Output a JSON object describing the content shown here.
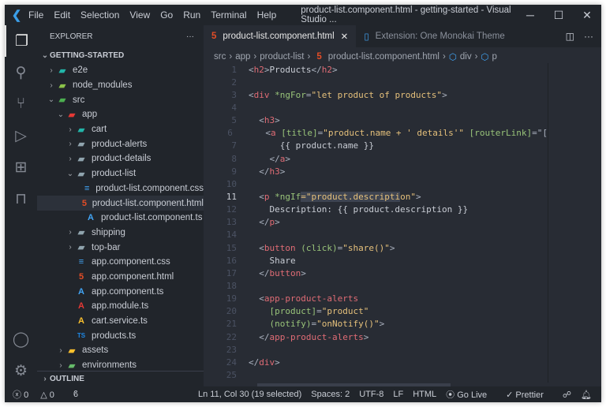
{
  "titlebar": {
    "menu": [
      "File",
      "Edit",
      "Selection",
      "View",
      "Go",
      "Run",
      "Terminal",
      "Help"
    ],
    "title": "product-list.component.html - getting-started - Visual Studio ..."
  },
  "sidebar": {
    "header": "EXPLORER",
    "more": "···",
    "section": "GETTING-STARTED",
    "outline": "OUTLINE",
    "items": [
      {
        "label": "e2e",
        "depth": 0,
        "chev": "›",
        "icon": "folder-e2e-icon",
        "color": "#22b5a9",
        "g": "▰"
      },
      {
        "label": "node_modules",
        "depth": 0,
        "chev": "›",
        "icon": "folder-node-icon",
        "color": "#8bc34a",
        "g": "▰"
      },
      {
        "label": "src",
        "depth": 0,
        "chev": "⌄",
        "icon": "folder-src-icon",
        "color": "#4caf50",
        "g": "▰"
      },
      {
        "label": "app",
        "depth": 1,
        "chev": "⌄",
        "icon": "folder-app-icon",
        "color": "#e53935",
        "g": "▰"
      },
      {
        "label": "cart",
        "depth": 2,
        "chev": "›",
        "icon": "folder-cart-icon",
        "color": "#22b5a9",
        "g": "▰"
      },
      {
        "label": "product-alerts",
        "depth": 2,
        "chev": "›",
        "icon": "folder-icon",
        "color": "#90a4ae",
        "g": "▰"
      },
      {
        "label": "product-details",
        "depth": 2,
        "chev": "›",
        "icon": "folder-icon",
        "color": "#90a4ae",
        "g": "▰"
      },
      {
        "label": "product-list",
        "depth": 2,
        "chev": "⌄",
        "icon": "folder-open-icon",
        "color": "#90a4ae",
        "g": "▰"
      },
      {
        "label": "product-list.component.css",
        "depth": 3,
        "chev": "",
        "icon": "css-icon",
        "color": "#42a5f5",
        "g": "≡"
      },
      {
        "label": "product-list.component.html",
        "depth": 3,
        "chev": "",
        "icon": "html-icon",
        "color": "#e44d26",
        "g": "5",
        "selected": true
      },
      {
        "label": "product-list.component.ts",
        "depth": 3,
        "chev": "",
        "icon": "angular-ts-icon",
        "color": "#42a5f5",
        "g": "A"
      },
      {
        "label": "shipping",
        "depth": 2,
        "chev": "›",
        "icon": "folder-icon",
        "color": "#90a4ae",
        "g": "▰"
      },
      {
        "label": "top-bar",
        "depth": 2,
        "chev": "›",
        "icon": "folder-icon",
        "color": "#90a4ae",
        "g": "▰"
      },
      {
        "label": "app.component.css",
        "depth": 2,
        "chev": "",
        "icon": "css-icon",
        "color": "#42a5f5",
        "g": "≡"
      },
      {
        "label": "app.component.html",
        "depth": 2,
        "chev": "",
        "icon": "html-icon",
        "color": "#e44d26",
        "g": "5"
      },
      {
        "label": "app.component.ts",
        "depth": 2,
        "chev": "",
        "icon": "angular-ts-icon",
        "color": "#42a5f5",
        "g": "A"
      },
      {
        "label": "app.module.ts",
        "depth": 2,
        "chev": "",
        "icon": "angular-module-icon",
        "color": "#e53935",
        "g": "A"
      },
      {
        "label": "cart.service.ts",
        "depth": 2,
        "chev": "",
        "icon": "angular-service-icon",
        "color": "#fbc02d",
        "g": "A"
      },
      {
        "label": "products.ts",
        "depth": 2,
        "chev": "",
        "icon": "ts-icon",
        "color": "#1e88e5",
        "g": "TS"
      },
      {
        "label": "assets",
        "depth": 1,
        "chev": "›",
        "icon": "folder-assets-icon",
        "color": "#fbc02d",
        "g": "▰"
      },
      {
        "label": "environments",
        "depth": 1,
        "chev": "›",
        "icon": "folder-env-icon",
        "color": "#66bb6a",
        "g": "▰"
      }
    ]
  },
  "tabs": [
    {
      "label": "product-list.component.html",
      "active": true,
      "close": "✕"
    },
    {
      "label": "Extension: One Monokai Theme",
      "active": false
    }
  ],
  "breadcrumb": [
    "src",
    "app",
    "product-list",
    "product-list.component.html",
    "div",
    "p"
  ],
  "editor": {
    "current_line": 11,
    "lines": [
      [
        [
          "<",
          "p"
        ],
        [
          "h2",
          "t"
        ],
        [
          ">",
          "p"
        ],
        [
          "Products",
          "x"
        ],
        [
          "</",
          "p"
        ],
        [
          "h2",
          "t"
        ],
        [
          ">",
          "p"
        ]
      ],
      [],
      [
        [
          "<",
          "p"
        ],
        [
          "div",
          "t"
        ],
        [
          " *ngFor",
          "a"
        ],
        [
          "=",
          "p"
        ],
        [
          "\"let product of products\"",
          "s"
        ],
        [
          ">",
          "p"
        ]
      ],
      [],
      [
        [
          "  <",
          "p"
        ],
        [
          "h3",
          "t"
        ],
        [
          ">",
          "p"
        ]
      ],
      [
        [
          "    <",
          "p"
        ],
        [
          "a",
          "t"
        ],
        [
          " [title]",
          "a"
        ],
        [
          "=",
          "p"
        ],
        [
          "\"product.name + ' details'\"",
          "s"
        ],
        [
          " [routerLink]",
          "a"
        ],
        [
          "=\"[",
          "p"
        ]
      ],
      [
        [
          "      {{ product.name }}",
          "x"
        ]
      ],
      [
        [
          "    </",
          "p"
        ],
        [
          "a",
          "t"
        ],
        [
          ">",
          "p"
        ]
      ],
      [
        [
          "  </",
          "p"
        ],
        [
          "h3",
          "t"
        ],
        [
          ">",
          "p"
        ]
      ],
      [],
      [
        [
          "  <",
          "p"
        ],
        [
          "p",
          "t"
        ],
        [
          " *ngIf",
          "a"
        ],
        [
          "=\"product.descripti",
          "s hl"
        ],
        [
          "on\"",
          "s"
        ],
        [
          ">",
          "p"
        ]
      ],
      [
        [
          "    Description: {{ product.description }}",
          "x"
        ]
      ],
      [
        [
          "  </",
          "p"
        ],
        [
          "p",
          "t"
        ],
        [
          ">",
          "p"
        ]
      ],
      [],
      [
        [
          "  <",
          "p"
        ],
        [
          "button",
          "t"
        ],
        [
          " (click)",
          "a"
        ],
        [
          "=",
          "p"
        ],
        [
          "\"share()\"",
          "s"
        ],
        [
          ">",
          "p"
        ]
      ],
      [
        [
          "    Share",
          "x"
        ]
      ],
      [
        [
          "  </",
          "p"
        ],
        [
          "button",
          "t"
        ],
        [
          ">",
          "p"
        ]
      ],
      [],
      [
        [
          "  <",
          "p"
        ],
        [
          "app-product-alerts",
          "t"
        ]
      ],
      [
        [
          "    [product]",
          "a"
        ],
        [
          "=",
          "p"
        ],
        [
          "\"product\"",
          "s"
        ]
      ],
      [
        [
          "    (notify)",
          "a"
        ],
        [
          "=",
          "p"
        ],
        [
          "\"onNotify()\"",
          "s"
        ],
        [
          ">",
          "p"
        ]
      ],
      [
        [
          "  </",
          "p"
        ],
        [
          "app-product-alerts",
          "t"
        ],
        [
          ">",
          "p"
        ]
      ],
      [],
      [
        [
          "</",
          "p"
        ],
        [
          "div",
          "t"
        ],
        [
          ">",
          "p"
        ]
      ],
      []
    ]
  },
  "status": {
    "errors": "0",
    "warnings": "0",
    "position": "Ln 11, Col 30 (19 selected)",
    "spaces": "Spaces: 2",
    "encoding": "UTF-8",
    "eol": "LF",
    "language": "HTML",
    "golive": "Go Live",
    "prettier": "Prettier"
  }
}
